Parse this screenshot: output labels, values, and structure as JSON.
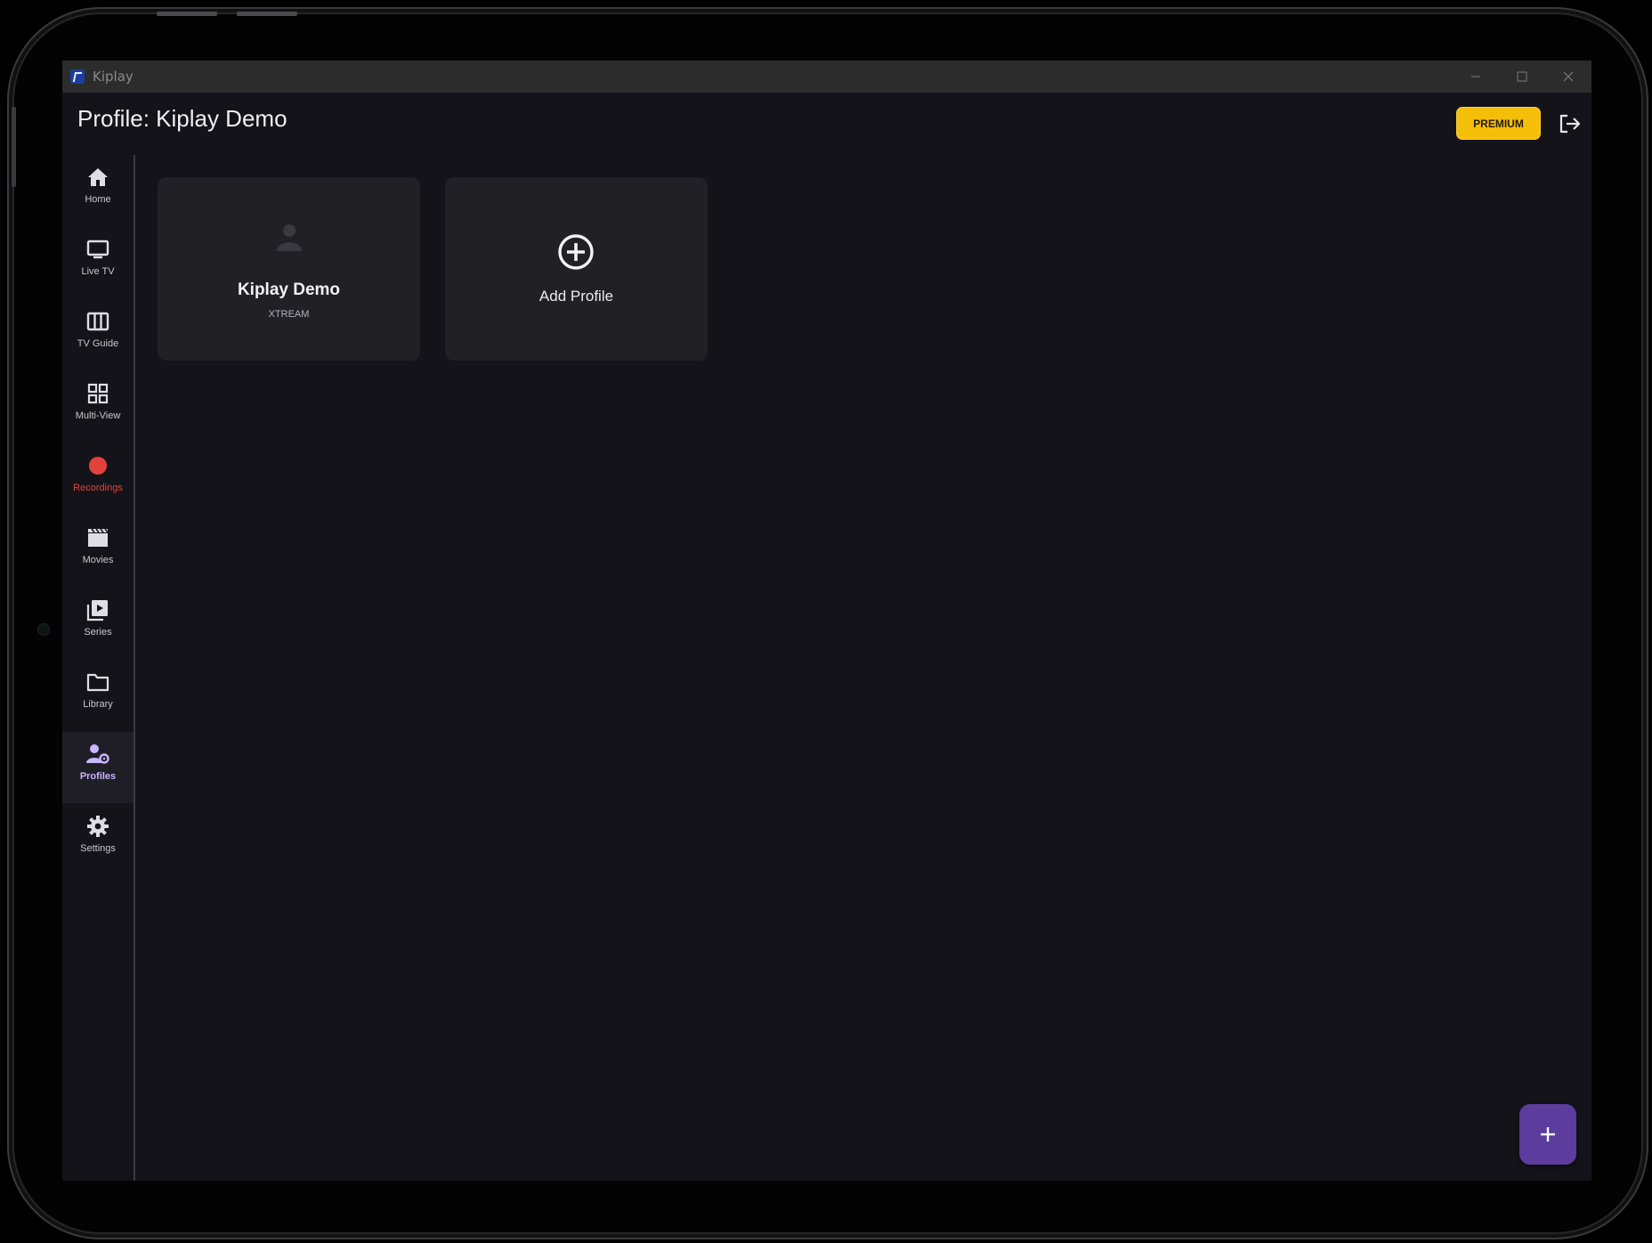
{
  "window": {
    "app_title": "Kiplay"
  },
  "header": {
    "title": "Profile: Kiplay Demo",
    "premium_label": "PREMIUM"
  },
  "sidebar": {
    "items": [
      {
        "label": "Home",
        "icon": "home-icon"
      },
      {
        "label": "Live TV",
        "icon": "tv-icon"
      },
      {
        "label": "TV Guide",
        "icon": "tv-guide-icon"
      },
      {
        "label": "Multi-View",
        "icon": "multi-view-icon"
      },
      {
        "label": "Recordings",
        "icon": "record-icon"
      },
      {
        "label": "Movies",
        "icon": "movies-icon"
      },
      {
        "label": "Series",
        "icon": "series-icon"
      },
      {
        "label": "Library",
        "icon": "folder-icon"
      },
      {
        "label": "Profiles",
        "icon": "profiles-icon"
      },
      {
        "label": "Settings",
        "icon": "settings-icon"
      }
    ],
    "active": "Profiles"
  },
  "profiles": [
    {
      "name": "Kiplay Demo",
      "type": "XTREAM"
    }
  ],
  "add_profile": {
    "label": "Add Profile"
  },
  "colors": {
    "background": "#14131a",
    "card": "#212025",
    "premium": "#f5be08",
    "accent": "#5c3d9e",
    "active_label": "#c8b6ff",
    "recording": "#e5413b"
  }
}
